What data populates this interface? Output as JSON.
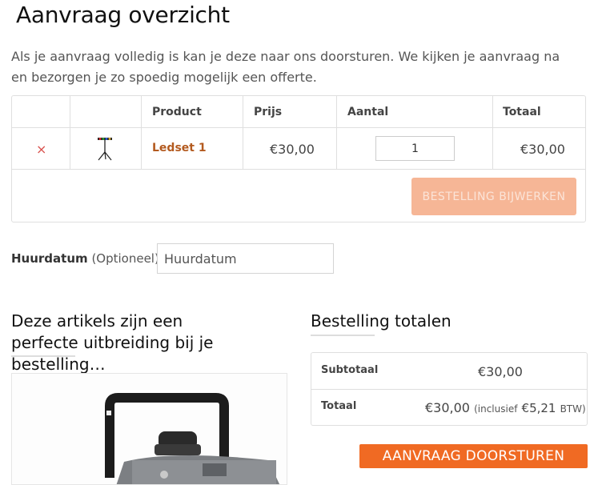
{
  "page": {
    "title": "Aanvraag overzicht",
    "intro": "Als je aanvraag volledig is kan je deze naar ons doorsturen. We kijken je aanvraag na en bezorgen je zo spoedig mogelijk een offerte."
  },
  "cart": {
    "headers": {
      "product": "Product",
      "price": "Prijs",
      "quantity": "Aantal",
      "total": "Totaal"
    },
    "rows": [
      {
        "remove": "×",
        "product": "Ledset 1",
        "price": "€30,00",
        "quantity": "1",
        "total": "€30,00",
        "thumbnail_icon": "led-light-stand-icon"
      }
    ],
    "update_button": "BESTELLING BIJWERKEN"
  },
  "rental_date": {
    "label": "Huurdatum",
    "optional": "(Optioneel)",
    "placeholder": "Huurdatum"
  },
  "upsell": {
    "heading": "Deze artikels zijn een perfecte uitbreiding bij je bestelling…",
    "product_image_icon": "smoke-machine-icon"
  },
  "totals": {
    "heading": "Bestelling totalen",
    "subtotal_label": "Subtotaal",
    "subtotal_value": "€30,00",
    "total_label": "Totaal",
    "total_value": "€30,00",
    "total_tax_prefix": "(inclusief",
    "total_tax_amount": "€5,21",
    "total_tax_suffix": "BTW)"
  },
  "submit_button": "AANVRAAG DOORSTUREN",
  "colors": {
    "accent": "#f06a23",
    "accent_disabled": "#f6b696",
    "product_link": "#b35a1f",
    "remove": "#d9534f"
  }
}
